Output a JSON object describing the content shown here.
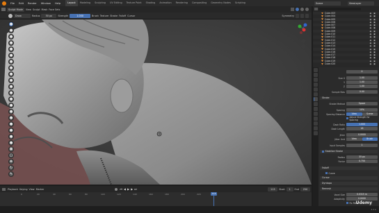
{
  "menu": {
    "items": [
      "File",
      "Edit",
      "Render",
      "Window",
      "Help"
    ],
    "workspaces": [
      "Layout",
      "Modeling",
      "Sculpting",
      "UV Editing",
      "Texture Paint",
      "Shading",
      "Animation",
      "Rendering",
      "Compositing",
      "Geometry Nodes",
      "Scripting"
    ],
    "active_workspace": "Layout",
    "scene_label": "Scene",
    "view_layer_label": "ViewLayer"
  },
  "viewport_header": {
    "mode": "Sculpt Mode",
    "items": [
      "View",
      "Sculpt",
      "Mask",
      "Face Sets"
    ]
  },
  "tool_settings": {
    "brush": "Draw",
    "radius_label": "Radius",
    "radius_value": "50 px",
    "strength_label": "Strength",
    "strength_value": "1.000",
    "items": [
      "Brush",
      "Texture",
      "Stroke",
      "Falloff",
      "Cursor"
    ],
    "symmetry_label": "Symmetry"
  },
  "outliner": {
    "rows": [
      "Cube.003",
      "Cube.004",
      "Cube.005",
      "Cube.006",
      "Cube.007",
      "Cube.008",
      "Cube.009",
      "Cube.010",
      "Cube.011",
      "Cube.012",
      "Cube.013",
      "Cube.014",
      "Cube.015",
      "Cube.016",
      "Cube.017",
      "Cube.018",
      "Cube.019",
      "Cube.020"
    ]
  },
  "properties": {
    "fields": [
      {
        "label": "",
        "value": "0"
      },
      {
        "label": "Size X",
        "value": "1.00"
      },
      {
        "label": "Y",
        "value": "1.00"
      },
      {
        "label": "Z",
        "value": "1.00"
      },
      {
        "label": "Sample Bias",
        "value": "0.00"
      }
    ],
    "stroke_panel": "Stroke",
    "stroke_method_label": "Stroke Method",
    "stroke_method_value": "Space",
    "spacing_label": "Spacing",
    "spacing_value": "10%",
    "spacing_distance_label": "Spacing Distance",
    "spacing_distance_options": [
      "View",
      "Scene"
    ],
    "adjust_strength_label": "Adjust Strength for Spacing",
    "dash_ratio_label": "Dash Ratio",
    "dash_ratio_value": "1.000",
    "dash_length_label": "Dash Length",
    "dash_length_value": "18",
    "jitter_label": "Jitter",
    "jitter_value": "0.0000",
    "jitter_unit_label": "Jitter Unit",
    "jitter_unit_options": [
      "View",
      "Brush"
    ],
    "input_samples_label": "Input Samples",
    "input_samples_value": "1",
    "stabilize_panel": "Stabilize Stroke",
    "radius_label": "Radius",
    "radius_value": "35 px",
    "factor_label": "Factor",
    "factor_value": "0.750",
    "falloff_panel": "Falloff",
    "curve_label": "Curve",
    "cursor_panel": "Cursor",
    "dyntopo_panel": "Dyntopo",
    "remesh_panel": "Remesh",
    "voxel_size_label": "Voxel Size",
    "voxel_size_value": "0.0315 m",
    "adaptivity_label": "Adaptivity",
    "adaptivity_value": "0.0000",
    "fix_poles_label": "Fix Poles"
  },
  "timeline": {
    "items": [
      "Playback",
      "Keying",
      "View",
      "Marker"
    ],
    "current_frame": "113",
    "start_label": "Start",
    "start_value": "1",
    "end_label": "End",
    "end_value": "250",
    "ticks": [
      "0",
      "20",
      "40",
      "60",
      "80",
      "100",
      "120",
      "140",
      "160",
      "180",
      "200",
      "220",
      "240"
    ]
  },
  "status": {
    "version": "3.3.0"
  },
  "watermark": "Udemy",
  "colors": {
    "accent": "#4772b3",
    "object_icon": "#e8903a"
  }
}
